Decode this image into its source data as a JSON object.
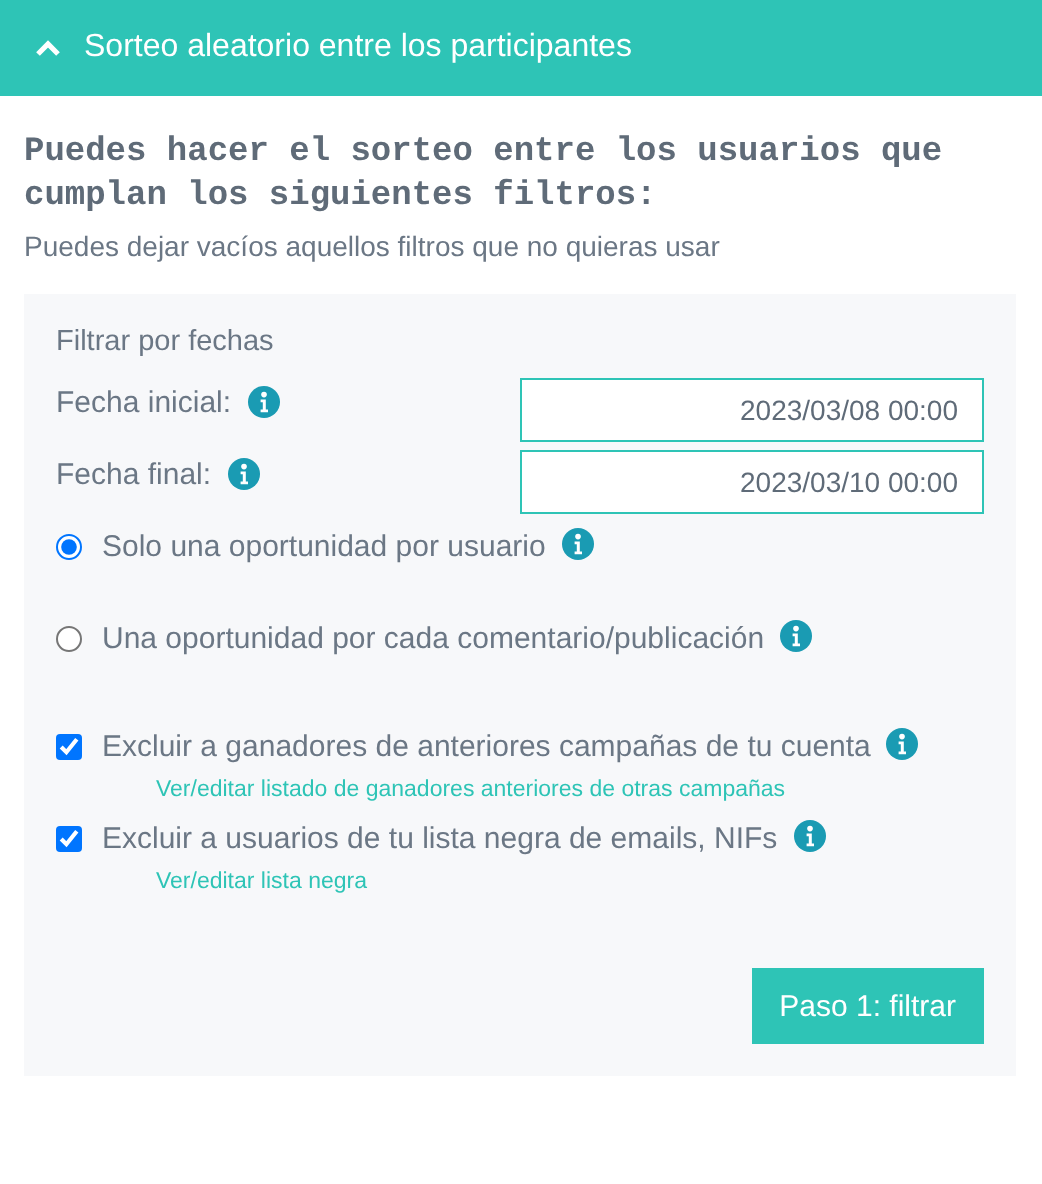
{
  "header": {
    "title": "Sorteo aleatorio entre los participantes",
    "expanded": true
  },
  "heading": "Puedes hacer el sorteo entre los usuarios que cumplan los siguientes filtros:",
  "subtitle": "Puedes dejar vacíos aquellos filtros que no quieras usar",
  "panel": {
    "title": "Filtrar por fechas",
    "dates": [
      {
        "label": "Fecha inicial:",
        "value": "2023/03/08 00:00"
      },
      {
        "label": "Fecha final:",
        "value": "2023/03/10 00:00"
      }
    ],
    "options": [
      {
        "kind": "radio",
        "label": "Solo una oportunidad por usuario",
        "selected": true
      },
      {
        "kind": "radio",
        "label": "Una oportunidad por cada comentario/publicación",
        "selected": false
      },
      {
        "kind": "checkbox",
        "label": "Excluir a ganadores de anteriores campañas de tu cuenta",
        "checked": true,
        "link": "Ver/editar listado de ganadores anteriores de otras campañas"
      },
      {
        "kind": "checkbox",
        "label": "Excluir a usuarios de tu lista negra de emails, NIFs",
        "checked": true,
        "link": "Ver/editar lista negra"
      }
    ],
    "button": "Paso 1: filtrar"
  }
}
